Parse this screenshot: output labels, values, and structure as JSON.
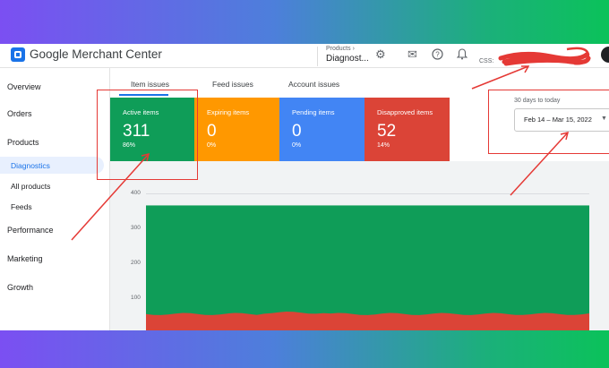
{
  "header": {
    "brand": "Google Merchant Center",
    "breadcrumb_parent": "Products ›",
    "breadcrumb_current": "Diagnost...",
    "css_label": "CSS:"
  },
  "sidebar": {
    "items": [
      {
        "label": "Overview"
      },
      {
        "label": "Orders"
      },
      {
        "label": "Products"
      },
      {
        "label": "Diagnostics"
      },
      {
        "label": "All products"
      },
      {
        "label": "Feeds"
      },
      {
        "label": "Performance"
      },
      {
        "label": "Marketing"
      },
      {
        "label": "Growth"
      }
    ]
  },
  "tabs": [
    "Item issues",
    "Feed issues",
    "Account issues"
  ],
  "cards": [
    {
      "title": "Active items",
      "value": "311",
      "percent": "86%",
      "color": "#0f9d58"
    },
    {
      "title": "Expiring items",
      "value": "0",
      "percent": "0%",
      "color": "#ff9800"
    },
    {
      "title": "Pending items",
      "value": "0",
      "percent": "0%",
      "color": "#4285f4"
    },
    {
      "title": "Disapproved items",
      "value": "52",
      "percent": "14%",
      "color": "#db4437"
    }
  ],
  "date_range": {
    "label": "30 days to today",
    "value": "Feb 14 – Mar 15, 2022"
  },
  "chart_data": {
    "type": "area",
    "y_ticks": [
      "400",
      "300",
      "200",
      "100"
    ],
    "ylim": [
      0,
      400
    ],
    "series": [
      {
        "values": [
          363
        ],
        "color": "#0f9d58"
      },
      {
        "values": [
          52
        ],
        "color": "#db4437"
      }
    ]
  },
  "colors": {
    "accent": "#1a73e8",
    "annotation": "#e53935"
  }
}
